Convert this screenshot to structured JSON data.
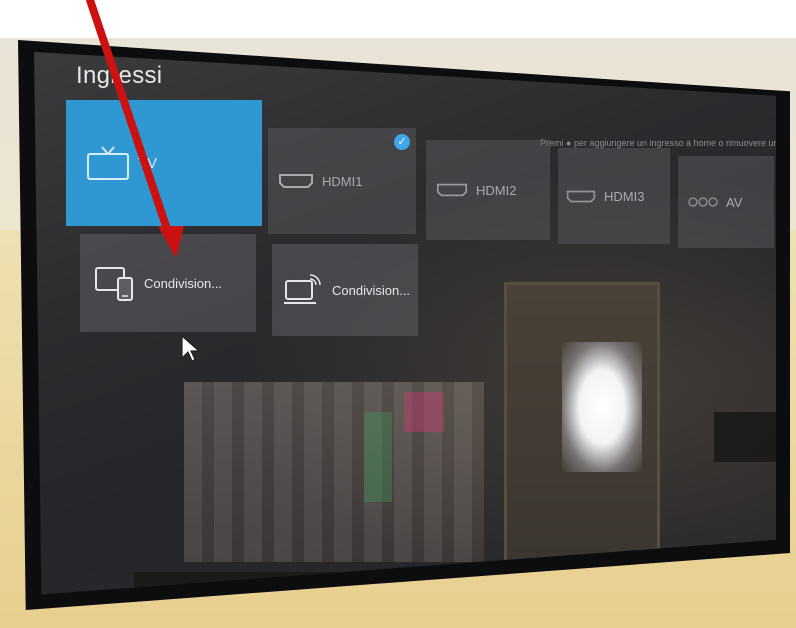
{
  "screen": {
    "title": "Ingressi",
    "hint": "Premi ● per aggiungere un ingresso a home o rimuovere un ingresso"
  },
  "inputs_row1": [
    {
      "label": "TV",
      "icon": "tv-icon",
      "selected": true
    },
    {
      "label": "HDMI1",
      "icon": "hdmi-icon",
      "connected": true
    },
    {
      "label": "HDMI2",
      "icon": "hdmi-icon"
    },
    {
      "label": "HDMI3",
      "icon": "hdmi-icon"
    },
    {
      "label": "AV",
      "icon": "av-icon"
    }
  ],
  "inputs_row2": [
    {
      "label": "Condivision...",
      "icon": "screen-share-devices-icon"
    },
    {
      "label": "Condivision...",
      "icon": "wireless-display-icon"
    }
  ],
  "colors": {
    "selected_tile": "#2f97d2",
    "check_badge": "#3ea6e8",
    "annotation_arrow": "#cc1111"
  }
}
